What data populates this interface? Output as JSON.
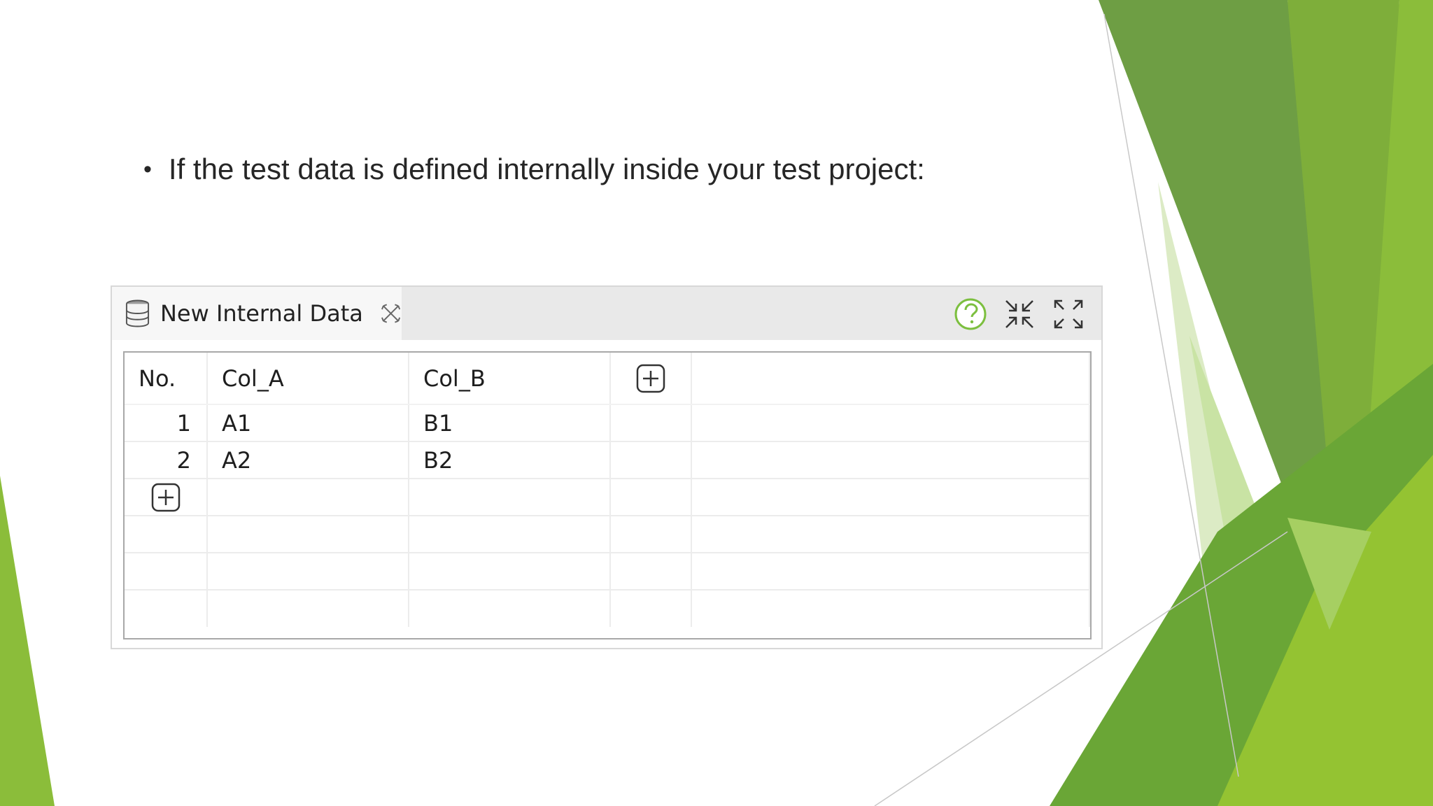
{
  "slide": {
    "bullet_text": "If the test data is defined internally inside your test project:",
    "bullet_symbol": "•",
    "accent_colors": [
      "#6e9e44",
      "#8bbd3a",
      "#5c8f2e",
      "#c9e3a4"
    ]
  },
  "editor": {
    "tab_icon": "database-icon",
    "tab_label": "New Internal Data",
    "tab_close_icon": "close-icon",
    "header_icons": [
      "help-icon",
      "minimize-icon",
      "maximize-icon"
    ],
    "help_icon_color": "#7cbf3f",
    "columns": [
      "No.",
      "Col_A",
      "Col_B"
    ],
    "add_column_icon": "plus-box-icon",
    "rows": [
      {
        "no": "1",
        "col_a": "A1",
        "col_b": "B1"
      },
      {
        "no": "2",
        "col_a": "A2",
        "col_b": "B2"
      }
    ],
    "add_row_icon": "plus-box-icon",
    "empty_row_count": 3
  }
}
